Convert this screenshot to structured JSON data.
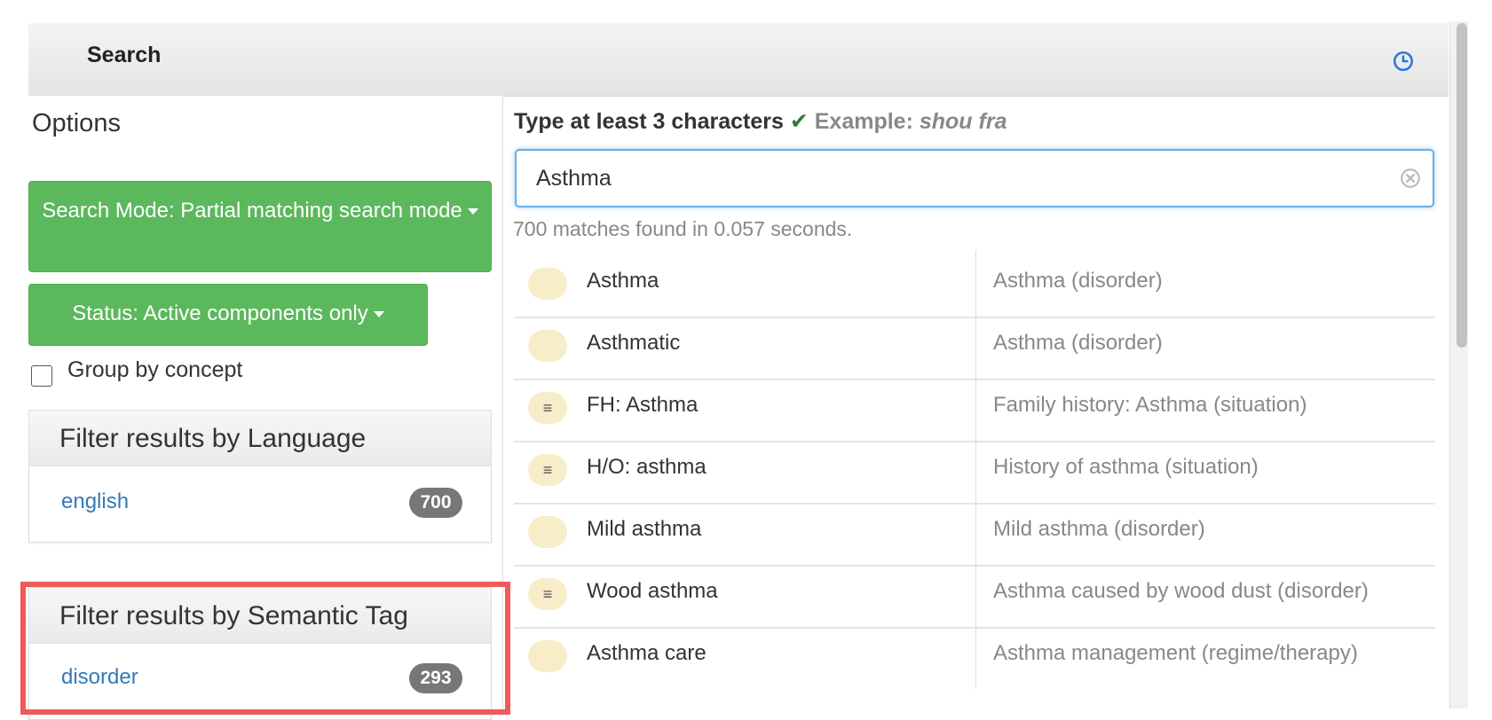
{
  "header": {
    "title": "Search",
    "history_icon": "history-clock-icon",
    "accent": "#2a7bd6"
  },
  "options": {
    "title": "Options",
    "search_mode_label": "Search Mode: Partial matching search mode",
    "status_label": "Status: Active components only",
    "group_by_label": "Group by concept",
    "group_by_checked": false,
    "button_color": "#5cb85c"
  },
  "filters": [
    {
      "heading": "Filter results by Language",
      "items": [
        {
          "label": "english",
          "count": "700"
        }
      ]
    },
    {
      "heading": "Filter results by Semantic Tag",
      "items": [
        {
          "label": "disorder",
          "count": "293"
        }
      ]
    }
  ],
  "search": {
    "hint_main": "Type at least 3 characters",
    "hint_check": "✔",
    "hint_example_label": "Example:",
    "hint_example_value": "shou fra",
    "query": "Asthma",
    "match_count": "700 matches found in 0.057 seconds."
  },
  "results": [
    {
      "term": "Asthma",
      "fsn": "Asthma (disorder)",
      "icon": ""
    },
    {
      "term": "Asthmatic",
      "fsn": "Asthma (disorder)",
      "icon": ""
    },
    {
      "term": "FH: Asthma",
      "fsn": "Family history: Asthma (situation)",
      "icon": "≡"
    },
    {
      "term": "H/O: asthma",
      "fsn": "History of asthma (situation)",
      "icon": "≡"
    },
    {
      "term": "Mild asthma",
      "fsn": "Mild asthma (disorder)",
      "icon": ""
    },
    {
      "term": "Wood asthma",
      "fsn": "Asthma caused by wood dust (disorder)",
      "icon": "≡"
    },
    {
      "term": "Asthma care",
      "fsn": "Asthma management (regime/therapy)",
      "icon": ""
    }
  ],
  "highlight_color": "#f05a5a"
}
